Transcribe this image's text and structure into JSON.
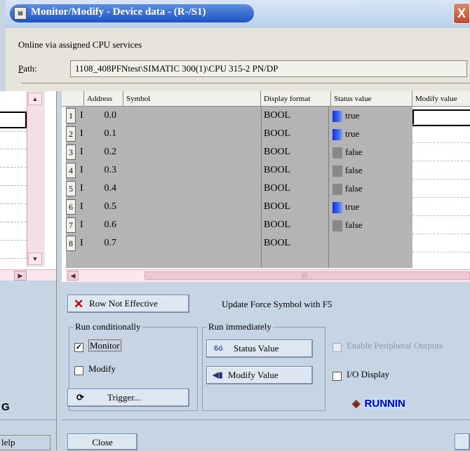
{
  "window": {
    "title": "Monitor/Modify - Device data - (R-/S1)",
    "close_glyph": "X",
    "title_icon": "monitor-icon"
  },
  "info": {
    "online_text": "Online via assigned CPU services",
    "path_label": "Path:",
    "path_value": "1108_408PFNtest\\SIMATIC 300(1)\\CPU 315-2 PN/DP"
  },
  "table": {
    "headers": [
      "Address",
      "Symbol",
      "Display format",
      "Status value",
      "Modify value"
    ],
    "rows": [
      {
        "num": "1",
        "area": "I",
        "addr": "0.0",
        "format": "BOOL",
        "status": "true",
        "on": true
      },
      {
        "num": "2",
        "area": "I",
        "addr": "0.1",
        "format": "BOOL",
        "status": "true",
        "on": true
      },
      {
        "num": "3",
        "area": "I",
        "addr": "0.2",
        "format": "BOOL",
        "status": "false",
        "on": false
      },
      {
        "num": "4",
        "area": "I",
        "addr": "0.3",
        "format": "BOOL",
        "status": "false",
        "on": false
      },
      {
        "num": "5",
        "area": "I",
        "addr": "0.4",
        "format": "BOOL",
        "status": "false",
        "on": false
      },
      {
        "num": "6",
        "area": "I",
        "addr": "0.5",
        "format": "BOOL",
        "status": "true",
        "on": true
      },
      {
        "num": "7",
        "area": "I",
        "addr": "0.6",
        "format": "BOOL",
        "status": "false",
        "on": false
      },
      {
        "num": "8",
        "area": "I",
        "addr": "0.7",
        "format": "BOOL",
        "status": "",
        "on": null
      }
    ]
  },
  "controls": {
    "row_not_effective": "Row Not Effective",
    "update_force_text": "Update Force Symbol with F5",
    "run_conditionally": "Run conditionally",
    "monitor_label": "Monitor",
    "monitor_checked": true,
    "modify_label": "Modify",
    "modify_checked": false,
    "trigger_label": "Trigger...",
    "run_immediately": "Run immediately",
    "status_value_btn": "Status Value",
    "modify_value_btn": "Modify Value",
    "enable_peripheral_label": "Enable Peripheral Outputs",
    "io_display_label": "I/O Display",
    "running_text": "RUNNIN",
    "close_label": "Close"
  },
  "background_window": {
    "letter": "G",
    "help_label": "lelp"
  },
  "colors": {
    "title_blue": "#1c52c0",
    "status_on": "#1a2fd0",
    "status_off": "#888888",
    "panel_bg": "#c6d4e4",
    "x_red": "#c00000"
  }
}
